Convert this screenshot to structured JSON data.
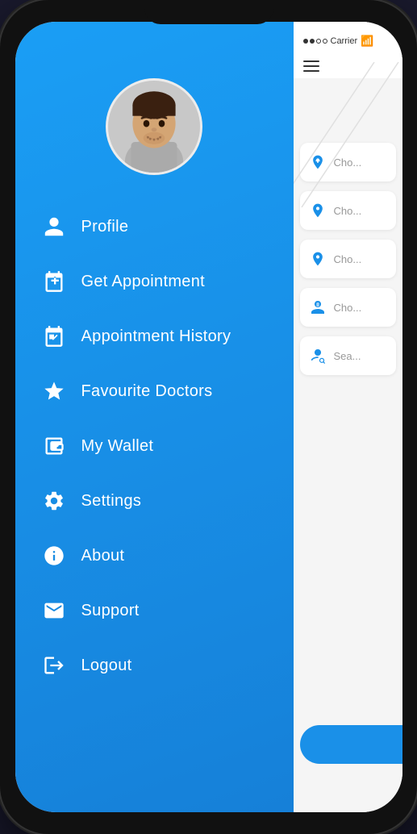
{
  "phone": {
    "status_bar": {
      "carrier": "Carrier",
      "wifi": "⇡"
    },
    "menu": {
      "items": [
        {
          "id": "profile",
          "label": "Profile",
          "icon": "person"
        },
        {
          "id": "get-appointment",
          "label": "Get Appointment",
          "icon": "calendar-plus"
        },
        {
          "id": "appointment-history",
          "label": "Appointment History",
          "icon": "calendar-check"
        },
        {
          "id": "favourite-doctors",
          "label": "Favourite Doctors",
          "icon": "star"
        },
        {
          "id": "my-wallet",
          "label": "My Wallet",
          "icon": "wallet"
        },
        {
          "id": "settings",
          "label": "Settings",
          "icon": "gear"
        },
        {
          "id": "about",
          "label": "About",
          "icon": "info"
        },
        {
          "id": "support",
          "label": "Support",
          "icon": "envelope"
        },
        {
          "id": "logout",
          "label": "Logout",
          "icon": "logout"
        }
      ]
    },
    "right_panel": {
      "dropdown_items": [
        {
          "label": "Cho"
        },
        {
          "label": "Cho"
        },
        {
          "label": "Cho"
        },
        {
          "label": "Cho"
        },
        {
          "label": "Sea"
        }
      ]
    }
  }
}
